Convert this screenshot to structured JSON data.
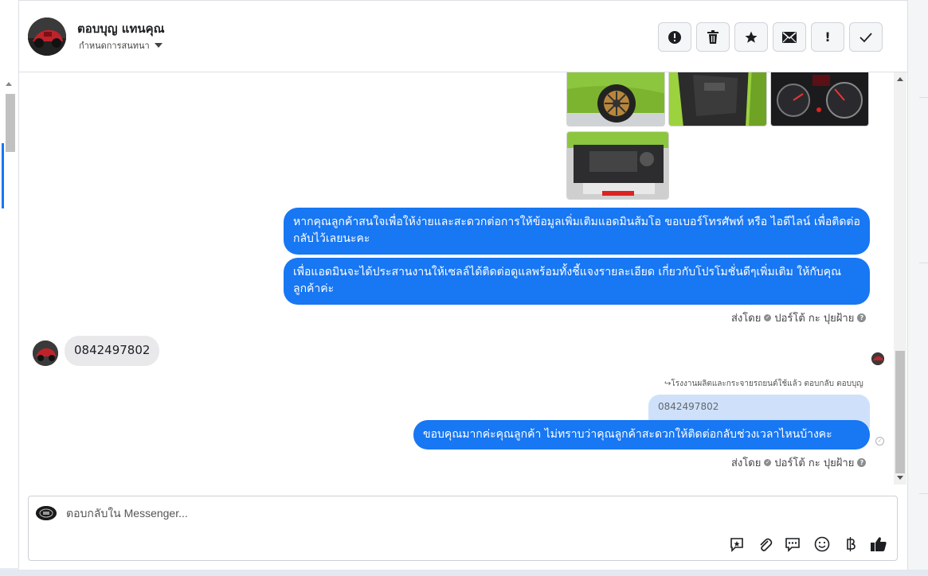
{
  "header": {
    "contact_name": "ตอบบุญ แทนคุณ",
    "assign_label": "กำหนดการสนทนา",
    "actions": [
      {
        "name": "report-icon",
        "label": "!"
      },
      {
        "name": "trash-icon",
        "label": ""
      },
      {
        "name": "star-icon",
        "label": ""
      },
      {
        "name": "mail-icon",
        "label": ""
      },
      {
        "name": "important-icon",
        "label": "!"
      },
      {
        "name": "check-icon",
        "label": ""
      }
    ]
  },
  "messages": {
    "outgoing_1": "หากคุณลูกค้าสนใจเพื่อให้ง่ายและสะดวกต่อการให้ข้อมูลเพิ่มเติมแอดมินส้มโอ ขอเบอร์โทรศัพท์ หรือ ไอดีไลน์ เพื่อติดต่อกลับไว้เลยนะคะ",
    "outgoing_2": "เพื่อแอดมินจะได้ประสานงานให้เซลล์ได้ติดต่อดูแลพร้อมทั้งชี้แจงรายละเอียด เกี่ยวกับโปรโมชั่นดีๆเพิ่มเติม ให้กับคุณลูกค้าค่ะ",
    "sent_by_prefix": "ส่งโดย",
    "sent_by_name": "ปอร์โต้ กะ ปุยฝ้าย",
    "incoming_1": "0842497802",
    "reply_note": "↪โรงงานผลิตและกระจายรถยนต์ใช้แล้ว ตอบกลับ ตอบบุญ",
    "quoted": "0842497802",
    "outgoing_3": "ขอบคุณมากค่ะคุณลูกค้า ไม่ทราบว่าคุณลูกค้าสะดวกให้ติดต่อกลับช่วงเวลาไหนบ้างคะ"
  },
  "composer": {
    "placeholder": "ตอบกลับใน Messenger...",
    "tools": [
      "saved-reply-icon",
      "attachment-icon",
      "chat-icon",
      "emoji-icon",
      "baht-icon",
      "like-icon"
    ]
  },
  "colors": {
    "accent": "#1877f2",
    "incoming_bubble": "#e9e9ec",
    "quote_bubble": "#cfe1fa"
  }
}
